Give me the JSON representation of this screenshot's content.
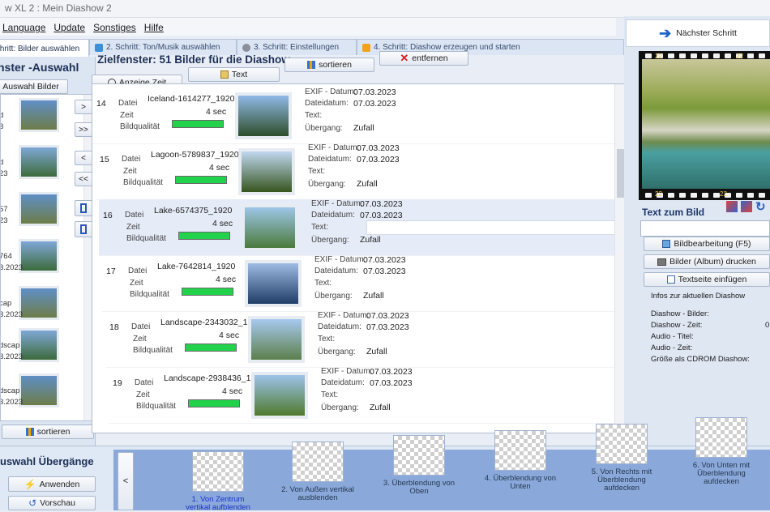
{
  "window": {
    "title": "w XL 2 : Mein Diashow 2"
  },
  "menu": [
    "Language",
    "Update",
    "Sonstiges",
    "Hilfe"
  ],
  "tabs": [
    {
      "label": "1. Schritt: Bilder auswählen"
    },
    {
      "label": "2. Schritt: Ton/Musik auswählen"
    },
    {
      "label": "3. Schritt: Einstellungen"
    },
    {
      "label": "4. Schritt: Diashow erzeugen und starten"
    }
  ],
  "left": {
    "title": "nster -Auswahl",
    "button": "Auswahl Bilder",
    "sort_label": "sortieren",
    "items": [
      {
        "name": "d",
        "date": "3"
      },
      {
        "name": "d",
        "date": "23"
      },
      {
        "name": "57",
        "date": "23"
      },
      {
        "name": "764",
        "date": "3.2023"
      },
      {
        "name": "cap",
        "date": "3.2023"
      },
      {
        "name": "dscap",
        "date": "3.2023"
      },
      {
        "name": "dscap",
        "date": "3.2023"
      }
    ]
  },
  "arrows": [
    ">",
    ">>",
    "<",
    "<<"
  ],
  "main": {
    "header": "Zielfenster: 51 Bilder für die Diashow",
    "toolbar": {
      "zeit": "Anzeige Zeit",
      "text": "Text",
      "sort": "sortieren",
      "remove": "entfernen"
    },
    "labels": {
      "datei": "Datei",
      "zeit": "Zeit",
      "qual": "Bildqualität",
      "exif": "EXIF - Datum:",
      "dateidatum": "Dateidatum:",
      "text": "Text:",
      "uebergang": "Übergang:"
    },
    "rows": [
      {
        "num": "14",
        "file": "Iceland-1614277_1920",
        "time": "4 sec",
        "quality": 1.0,
        "exif": "07.03.2023",
        "filedate": "07.03.2023",
        "transition": "Zufall",
        "selected": false
      },
      {
        "num": "15",
        "file": "Lagoon-5789837_1920",
        "time": "4 sec",
        "quality": 1.0,
        "exif": "07.03.2023",
        "filedate": "07.03.2023",
        "transition": "Zufall",
        "selected": false
      },
      {
        "num": "16",
        "file": "Lake-6574375_1920",
        "time": "4 sec",
        "quality": 1.0,
        "exif": "07.03.2023",
        "filedate": "07.03.2023",
        "transition": "Zufall",
        "selected": true
      },
      {
        "num": "17",
        "file": "Lake-7642814_1920",
        "time": "4 sec",
        "quality": 1.0,
        "exif": "07.03.2023",
        "filedate": "07.03.2023",
        "transition": "Zufall",
        "selected": false
      },
      {
        "num": "18",
        "file": "Landscape-2343032_1...",
        "time": "4 sec",
        "quality": 1.0,
        "exif": "07.03.2023",
        "filedate": "07.03.2023",
        "transition": "Zufall",
        "selected": false
      },
      {
        "num": "19",
        "file": "Landscape-2938436_1...",
        "time": "4 sec",
        "quality": 1.0,
        "exif": "07.03.2023",
        "filedate": "07.03.2023",
        "transition": "Zufall",
        "selected": false
      }
    ]
  },
  "right": {
    "next": "Nächster Schritt",
    "film_numbers": [
      "22",
      "22",
      "22",
      "22"
    ],
    "text_zum_bild": "Text zum Bild",
    "buttons": [
      "Bildbearbeitung (F5)",
      "Bilder (Album) drucken",
      "Textseite einfügen"
    ],
    "info_title": "Infos zur aktuellen Diashow",
    "info": [
      "Diashow - Bilder:",
      "Diashow - Zeit:",
      "Audio - Titel:",
      "Audio - Zeit:",
      "Größe als CDROM Diashow:"
    ],
    "info_values": [
      "",
      "0",
      "",
      "",
      ""
    ]
  },
  "bottom": {
    "title": "uswahl Übergänge",
    "apply": "Anwenden",
    "preview": "Vorschau",
    "transitions": [
      "1. Von Zentrum vertikal aufblenden",
      "2. Von Außen vertikal ausblenden",
      "3. Überblendung von Oben",
      "4. Überblendung von Unten",
      "5. Von Rechts mit Überblendung aufdecken",
      "6. Von Unten mit Überblendung aufdecken"
    ]
  },
  "colors": {
    "accent": "#1c2f55",
    "quality_bar": "#21d24a",
    "selection": "#e5ebf7",
    "transition_bg": "#8aa8d9"
  }
}
